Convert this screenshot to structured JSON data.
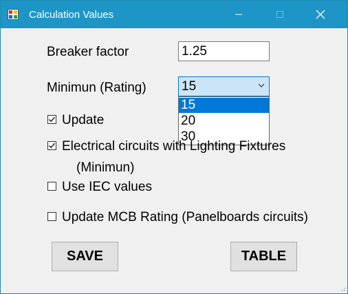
{
  "window": {
    "title": "Calculation Values",
    "icon": "app-form-icon",
    "controls": [
      "minimize-icon",
      "maximize-icon",
      "close-icon"
    ]
  },
  "fields": {
    "breaker_factor_label": "Breaker factor",
    "breaker_factor_value": "1.25",
    "minimum_rating_label": "Minimun (Rating)",
    "minimum_rating_selected": "15",
    "minimum_rating_options": [
      "15",
      "20",
      "30"
    ]
  },
  "checkboxes": {
    "update": {
      "label": "Update",
      "checked": true
    },
    "lighting": {
      "label": "Electrical circuits with Lighting Fixtures",
      "label_line2": "(Minimun)",
      "checked": true
    },
    "iec": {
      "label": "Use IEC values",
      "checked": false
    },
    "mcb": {
      "label": "Update MCB Rating (Panelboards circuits)",
      "checked": false
    }
  },
  "buttons": {
    "save": "SAVE",
    "table": "TABLE"
  },
  "colors": {
    "titlebar": "#1d95c7",
    "selection": "#0078d7",
    "combo_bg": "#cce4f7"
  }
}
